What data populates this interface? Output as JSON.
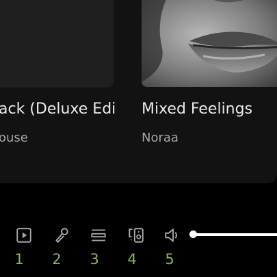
{
  "cards": [
    {
      "title": "ack (Deluxe Edi",
      "subtitle": "ouse"
    },
    {
      "title": "Mixed Feelings",
      "subtitle": "Noraa"
    }
  ],
  "controls": [
    {
      "icon": "now-playing-view-icon",
      "hint": "1"
    },
    {
      "icon": "microphone-icon",
      "hint": "2"
    },
    {
      "icon": "queue-icon",
      "hint": "3"
    },
    {
      "icon": "connect-device-icon",
      "hint": "4"
    },
    {
      "icon": "volume-icon",
      "hint": "5"
    }
  ],
  "volume": {
    "level": 1.0
  },
  "colors": {
    "background": "#000000",
    "panel": "#121212",
    "hint": "#8ab55a",
    "text": "#e8e8e8",
    "subtext": "#a6a6a6"
  }
}
